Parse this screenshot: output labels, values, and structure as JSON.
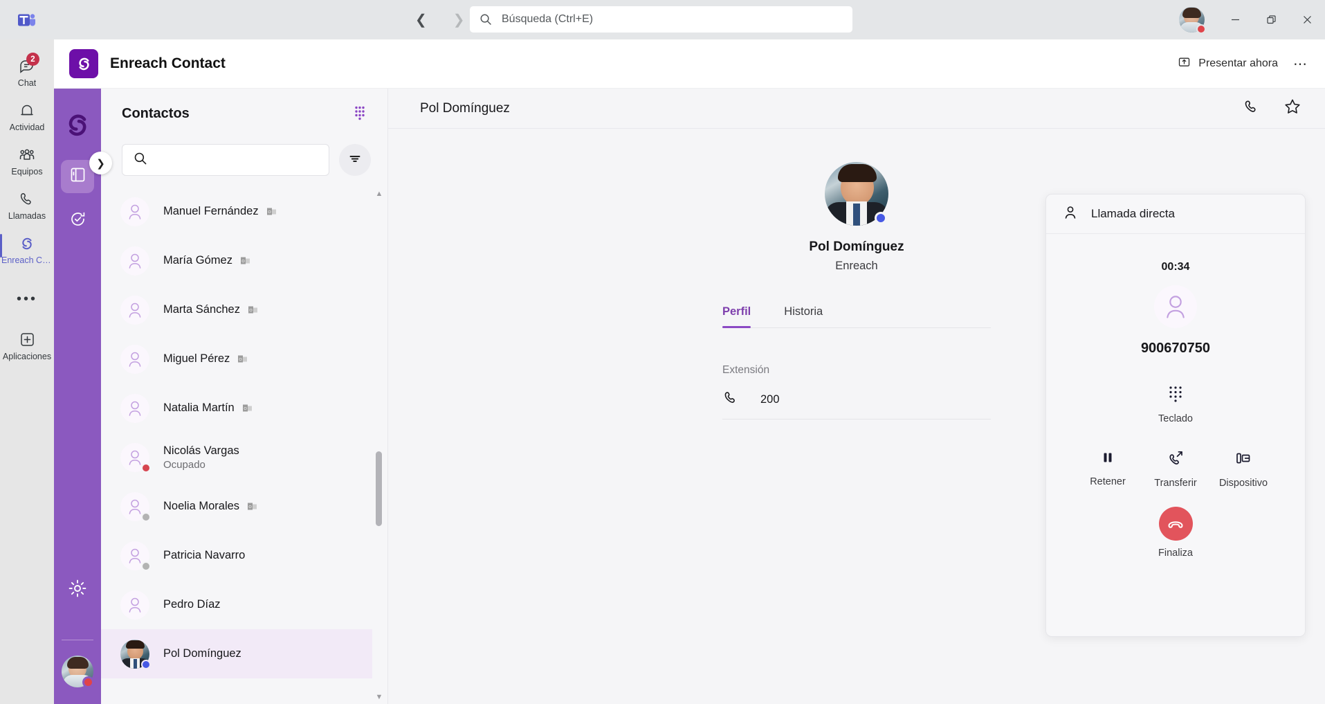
{
  "titlebar": {
    "logo_icon": "teams-logo-icon",
    "back_icon": "chevron-left-icon",
    "forward_icon": "chevron-right-icon",
    "search": {
      "placeholder": "Búsqueda (Ctrl+E)",
      "value": "",
      "icon": "search-icon"
    },
    "minimize_icon": "minimize-icon",
    "restore_icon": "restore-icon",
    "close_icon": "close-icon",
    "user_presence": "busy"
  },
  "rail": {
    "items": [
      {
        "label": "Chat",
        "icon": "chat-icon",
        "badge": "2",
        "active": false
      },
      {
        "label": "Actividad",
        "icon": "bell-icon",
        "badge": "",
        "active": false
      },
      {
        "label": "Equipos",
        "icon": "teams-people-icon",
        "badge": "",
        "active": false
      },
      {
        "label": "Llamadas",
        "icon": "phone-icon",
        "badge": "",
        "active": false
      },
      {
        "label": "Enreach Co...",
        "icon": "enreach-icon",
        "badge": "",
        "active": true
      }
    ],
    "more_label": "•••",
    "apps": {
      "label": "Aplicaciones",
      "icon": "plus-square-icon"
    }
  },
  "appheader": {
    "title": "Enreach Contact",
    "logo_icon": "enreach-logo-icon",
    "present_label": "Presentar ahora",
    "present_icon": "share-up-icon",
    "more_icon": "more-horizontal-icon"
  },
  "purple_rail": {
    "logo_icon": "enreach-mark-icon",
    "expand_icon": "chevron-right-icon",
    "buttons": [
      {
        "name": "contacts-panel",
        "icon": "book-panel-icon",
        "selected": true
      },
      {
        "name": "presence-panel",
        "icon": "clock-check-icon",
        "selected": false
      }
    ],
    "settings_icon": "gear-icon",
    "avatar_presence": "busy"
  },
  "contacts": {
    "title": "Contactos",
    "dialpad_icon": "dialpad-icon",
    "search": {
      "placeholder": "",
      "value": "",
      "icon": "search-icon"
    },
    "filter_icon": "filter-icon",
    "scroll_up_icon": "triangle-up-icon",
    "scroll_down_icon": "triangle-down-icon",
    "items": [
      {
        "name": "Manuel Fernández",
        "status": "",
        "presence": "",
        "badge": "outlook",
        "avatar": "generic",
        "selected": false
      },
      {
        "name": "María Gómez",
        "status": "",
        "presence": "",
        "badge": "outlook",
        "avatar": "generic",
        "selected": false
      },
      {
        "name": "Marta Sánchez",
        "status": "",
        "presence": "",
        "badge": "outlook",
        "avatar": "generic",
        "selected": false
      },
      {
        "name": "Miguel Pérez",
        "status": "",
        "presence": "",
        "badge": "outlook",
        "avatar": "generic",
        "selected": false
      },
      {
        "name": "Natalia Martín",
        "status": "",
        "presence": "",
        "badge": "outlook",
        "avatar": "generic",
        "selected": false
      },
      {
        "name": "Nicolás Vargas",
        "status": "Ocupado",
        "presence": "busy",
        "badge": "",
        "avatar": "generic",
        "selected": false
      },
      {
        "name": "Noelia Morales",
        "status": "",
        "presence": "offline",
        "badge": "outlook",
        "avatar": "generic",
        "selected": false
      },
      {
        "name": "Patricia Navarro",
        "status": "",
        "presence": "offline",
        "badge": "",
        "avatar": "generic",
        "selected": false
      },
      {
        "name": "Pedro Díaz",
        "status": "",
        "presence": "",
        "badge": "",
        "avatar": "generic",
        "selected": false
      },
      {
        "name": "Pol Domínguez",
        "status": "",
        "presence": "dnd-blue",
        "badge": "",
        "avatar": "photo",
        "selected": true
      }
    ]
  },
  "detail": {
    "header_name": "Pol Domínguez",
    "call_icon": "phone-icon",
    "favorite_icon": "star-icon",
    "profile_name": "Pol Domínguez",
    "profile_org": "Enreach",
    "profile_presence": "dnd-blue",
    "tabs": [
      {
        "label": "Perfil",
        "active": true
      },
      {
        "label": "Historia",
        "active": false
      }
    ],
    "field": {
      "label": "Extensión",
      "value": "200",
      "icon": "phone-icon"
    }
  },
  "call_panel": {
    "header": {
      "title": "Llamada directa",
      "icon": "person-icon"
    },
    "timer": "00:34",
    "avatar_icon": "generic-person-avatar",
    "number": "900670750",
    "keypad": {
      "label": "Teclado",
      "icon": "dialpad-icon"
    },
    "actions": [
      {
        "label": "Retener",
        "icon": "pause-icon"
      },
      {
        "label": "Transferir",
        "icon": "call-transfer-icon"
      },
      {
        "label": "Dispositivo",
        "icon": "device-icon"
      }
    ],
    "end": {
      "label": "Finaliza",
      "icon": "hangup-icon",
      "color": "#e2545c"
    }
  },
  "colors": {
    "teams_accent": "#5b5fc7",
    "enreach_purple": "#6d0fa8",
    "panel_purple": "#8b59bf",
    "tab_active": "#8b49c4",
    "busy_red": "#d64550",
    "end_call_red": "#e2545c",
    "dnd_blue": "#4759e4",
    "badge_red": "#c4314b"
  }
}
